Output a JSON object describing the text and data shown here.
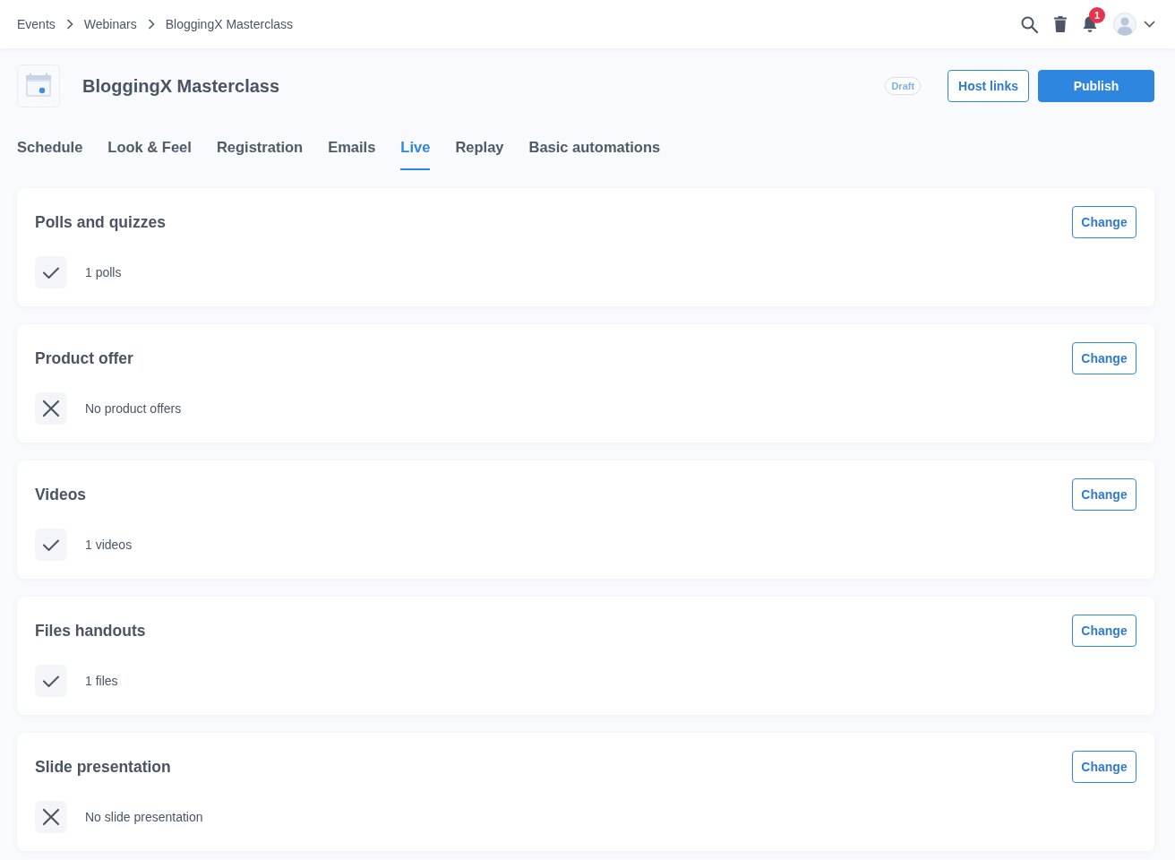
{
  "breadcrumbs": [
    {
      "label": "Events"
    },
    {
      "label": "Webinars"
    },
    {
      "label": "BloggingX Masterclass"
    }
  ],
  "notifications": {
    "count": "1"
  },
  "header": {
    "title": "BloggingX Masterclass",
    "status_badge": "Draft",
    "buttons": [
      {
        "label": "Host links",
        "kind": "outline"
      },
      {
        "label": "Publish",
        "kind": "primary"
      }
    ]
  },
  "tabs": [
    {
      "label": "Schedule",
      "selected": false
    },
    {
      "label": "Look & Feel",
      "selected": false
    },
    {
      "label": "Registration",
      "selected": false
    },
    {
      "label": "Emails",
      "selected": false
    },
    {
      "label": "Live",
      "selected": true
    },
    {
      "label": "Replay",
      "selected": false
    },
    {
      "label": "Basic automations",
      "selected": false
    }
  ],
  "sections": [
    {
      "title": "Polls and quizzes",
      "button": "Change",
      "configured": true,
      "summary": "1 polls"
    },
    {
      "title": "Product offer",
      "button": "Change",
      "configured": false,
      "summary": "No product offers"
    },
    {
      "title": "Videos",
      "button": "Change",
      "configured": true,
      "summary": "1 videos"
    },
    {
      "title": "Files handouts",
      "button": "Change",
      "configured": true,
      "summary": "1 files"
    },
    {
      "title": "Slide presentation",
      "button": "Change",
      "configured": false,
      "summary": "No slide presentation"
    }
  ]
}
